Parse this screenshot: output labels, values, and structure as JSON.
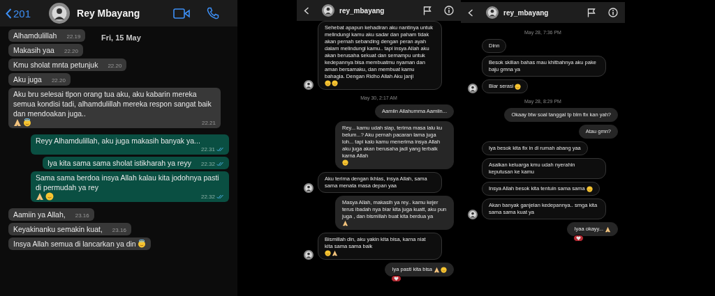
{
  "whatsapp": {
    "header": {
      "back_count": "201",
      "contact": "Rey Mbayang"
    },
    "date_chip": "Fri, 15 May",
    "messages": [
      {
        "text": "Alhamdulillah",
        "time": "22.19",
        "outgoing": false
      },
      {
        "text": "Makasih yaa",
        "time": "22.20",
        "outgoing": false
      },
      {
        "text": "Kmu sholat mnta petunjuk",
        "time": "22.20",
        "outgoing": false
      },
      {
        "text": "Aku juga",
        "time": "22.20",
        "outgoing": false
      },
      {
        "text": "Aku bru selesai tlpon orang tua aku, aku kabarin mereka semua kondisi tadi, alhamdulillah mereka respon sangat baik dan mendoakan juga..",
        "emoji": [
          {
            "kind": "pray"
          },
          {
            "kind": "halo"
          }
        ],
        "time": "22.21",
        "outgoing": false
      },
      {
        "text": "Reyy Alhamdulillah, aku juga makasih banyak ya...",
        "time": "22.31",
        "outgoing": true,
        "read": true
      },
      {
        "text": "Iya kita sama sama sholat istikharah ya reyy",
        "time": "22.32",
        "outgoing": true,
        "read": true
      },
      {
        "text": "Sama sama berdoa insya Allah kalau kita jodohnya pasti di permudah ya rey",
        "emoji": [
          {
            "kind": "pray"
          },
          {
            "kind": "smile"
          }
        ],
        "time": "22.32",
        "outgoing": true,
        "read": true
      },
      {
        "text": "Aamiin ya Allah,",
        "time": "23.16",
        "outgoing": false
      },
      {
        "text": "Keyakinanku semakin kuat,",
        "time": "23.16",
        "outgoing": false
      },
      {
        "text": "Insya Allah semua di lancarkan ya din",
        "emoji": [
          {
            "kind": "halo"
          }
        ],
        "outgoing": false
      }
    ]
  },
  "instagram_chats": [
    {
      "header": {
        "username": "rey_mbayang"
      },
      "items": [
        {
          "kind": "message",
          "text": "Sehebat apapun kehadiran aku nantinya untuk melindungi kamu aku sadar dan paham tidak akan pernah sebanding dengan peran ayah dalam melindungi kamu.. tapi insya Allah aku akan berusaha sekuat dan semampu untuk kedepannya bisa membuatmu nyaman dan aman bersamaku, dan membuat kamu bahagia. Dengan Ridho Allah Aku janji",
          "emoji": [
            {
              "kind": "smile"
            },
            {
              "kind": "smile"
            }
          ],
          "outgoing": false,
          "avatar": true
        },
        {
          "kind": "date",
          "text": "May 30, 2:17 AM"
        },
        {
          "kind": "message",
          "text": "Aamiin Allahumma Aamiin...",
          "outgoing": true
        },
        {
          "kind": "message",
          "text": "Rey... kamu udah siap, terima masa lalu ku belum...? Aku pernah pacaran lama juga loh... tapi kalo kamu menerima insya Allah aku juga akan berusaha jadi yang terbaik karna Allah",
          "emoji": [
            {
              "kind": "smile"
            }
          ],
          "outgoing": true
        },
        {
          "kind": "message",
          "text": "Aku terima dengan ikhlas, insya Allah, sama sama menata masa depan yaa",
          "outgoing": false,
          "avatar": true
        },
        {
          "kind": "message",
          "text": "Masya Allah, makasih ya rey.. kamu kejer terus ibadah nya biar kita juga kuatt, aku pun juga , dan bismillah buat kita berdua ya",
          "emoji": [
            {
              "kind": "pray"
            }
          ],
          "outgoing": true
        },
        {
          "kind": "message",
          "text": "Bismillah din, aku yakin kita bisa, karna niat kita sama sama baik",
          "emoji": [
            {
              "kind": "smile"
            },
            {
              "kind": "pray"
            }
          ],
          "outgoing": false,
          "avatar": true
        },
        {
          "kind": "message",
          "text": "Iya pasti kita bisa",
          "emoji": [
            {
              "kind": "pray"
            },
            {
              "kind": "smile"
            }
          ],
          "outgoing": true,
          "reaction": true
        }
      ]
    },
    {
      "header": {
        "username": "rey_mbayang"
      },
      "items": [
        {
          "kind": "date",
          "text": "May 28, 7:36 PM"
        },
        {
          "kind": "message",
          "text": "Dinn",
          "outgoing": false
        },
        {
          "kind": "message",
          "text": "Besok skilian bahas mau khitbahnya aku pake baju gmna ya",
          "outgoing": false
        },
        {
          "kind": "message",
          "text": "Biar serasi",
          "emoji": [
            {
              "kind": "smile"
            }
          ],
          "outgoing": false,
          "avatar": true
        },
        {
          "kind": "date",
          "text": "May 28, 8:29 PM"
        },
        {
          "kind": "message",
          "text": "Okaay btw soal tanggal tp blm fix kan yah?",
          "outgoing": true
        },
        {
          "kind": "message",
          "text": "Atau gmn?",
          "outgoing": true
        },
        {
          "kind": "message",
          "text": "Iya besok kita fix in di rumah abang yaa",
          "outgoing": false
        },
        {
          "kind": "message",
          "text": "Asalkan keluarga kmu udah nyerahin keputusan ke kamu",
          "outgoing": false
        },
        {
          "kind": "message",
          "text": "Insya Allah besok kita tentuin sama sama",
          "emoji": [
            {
              "kind": "smile"
            }
          ],
          "outgoing": false
        },
        {
          "kind": "message",
          "text": "Akan banyak ganjelan kedepannya.. smga kita sama sama kuat ya",
          "outgoing": false,
          "avatar": true
        },
        {
          "kind": "message",
          "text": "Iyaa okayy...",
          "emoji": [
            {
              "kind": "pray"
            }
          ],
          "outgoing": true,
          "reaction": true
        }
      ]
    }
  ]
}
